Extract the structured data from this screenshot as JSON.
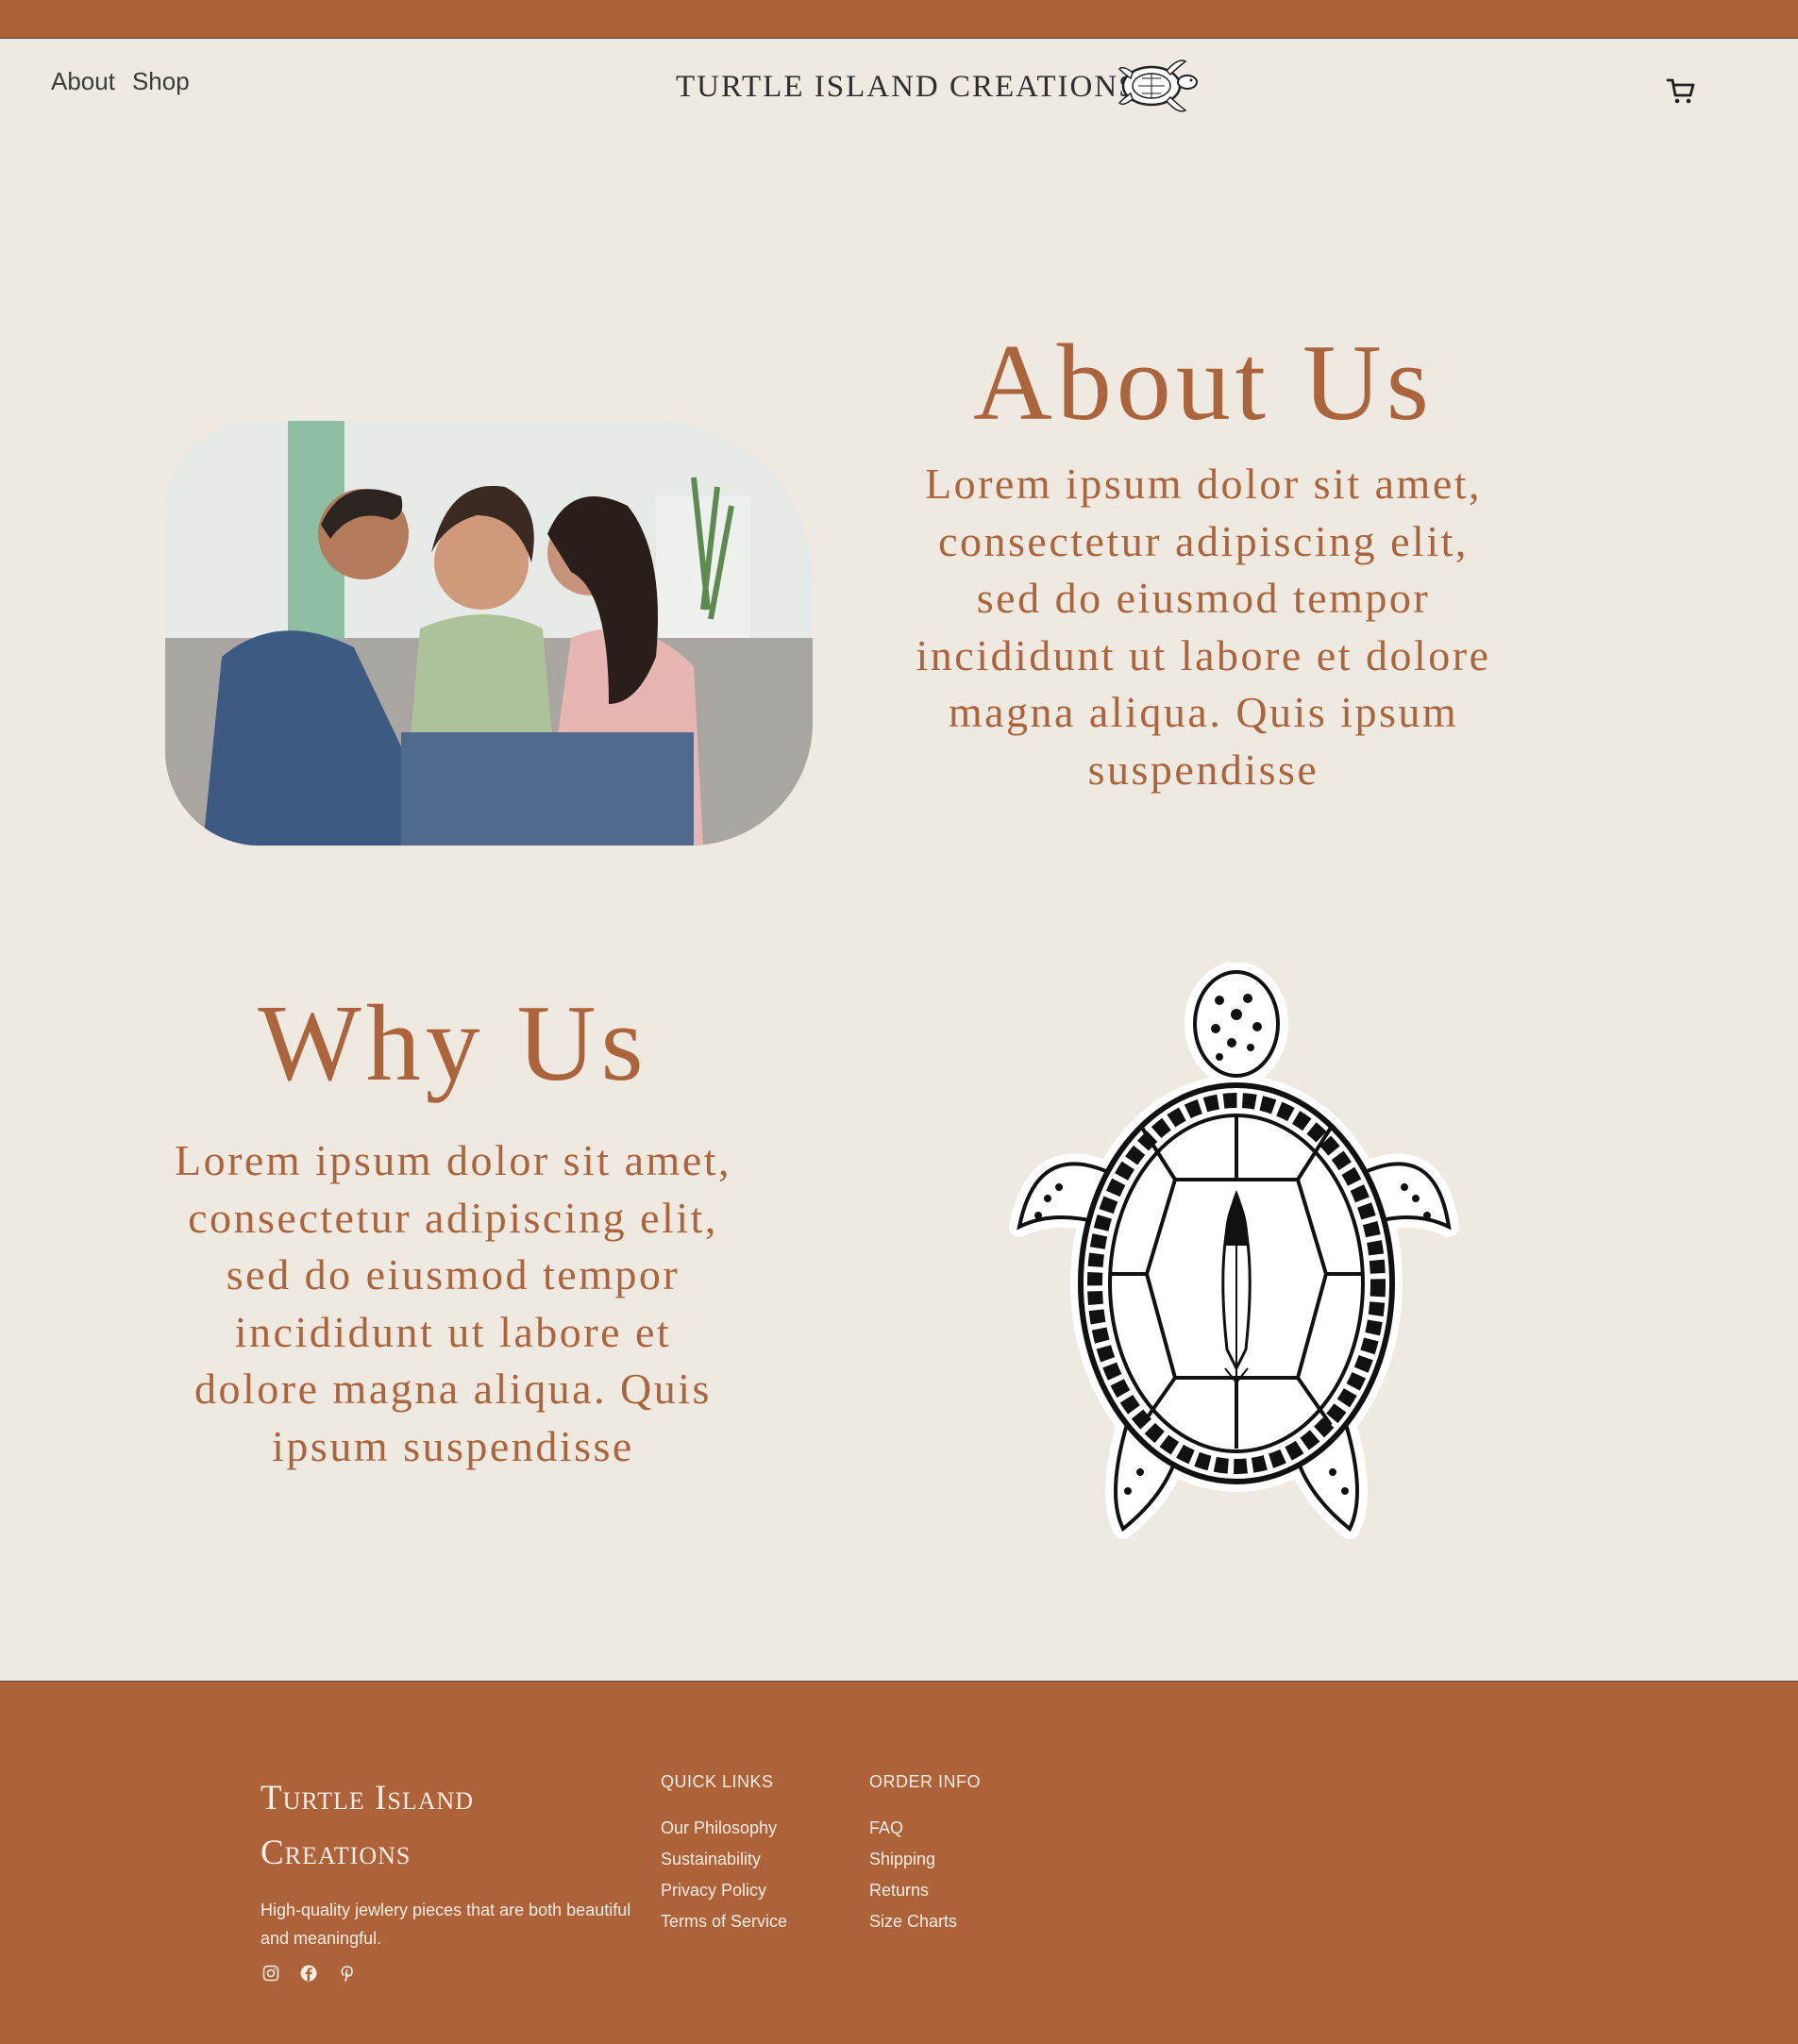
{
  "header": {
    "nav": [
      "About",
      "Shop"
    ],
    "brand": "TURTLE ISLAND CREATIONS",
    "logo_icon": "turtle-icon",
    "cart_icon": "cart-icon"
  },
  "about": {
    "title": "About Us",
    "body": "Lorem ipsum dolor sit amet, consectetur adipiscing elit, sed do eiusmod tempor incididunt ut labore et dolore magna aliqua. Quis ipsum suspendisse"
  },
  "why": {
    "title": "Why Us",
    "body": "Lorem ipsum dolor sit amet, consectetur adipiscing elit, sed do eiusmod tempor incididunt ut labore et dolore magna aliqua. Quis ipsum suspendisse"
  },
  "footer": {
    "brand_line1": "Turtle Island",
    "brand_line2": "Creations",
    "tagline": "High-quality jewlery pieces that are both beautiful and meaningful.",
    "socials": [
      "instagram-icon",
      "facebook-icon",
      "pinterest-icon"
    ],
    "quick_links": {
      "heading": "QUICK LINKS",
      "items": [
        "Our Philosophy",
        "Sustainability",
        "Privacy Policy",
        "Terms of Service"
      ]
    },
    "order_info": {
      "heading": "ORDER INFO",
      "items": [
        "FAQ",
        "Shipping",
        "Returns",
        "Size Charts"
      ]
    }
  },
  "colors": {
    "accent": "#ad623a",
    "background": "#efeae1",
    "heading": "#ac643d"
  }
}
